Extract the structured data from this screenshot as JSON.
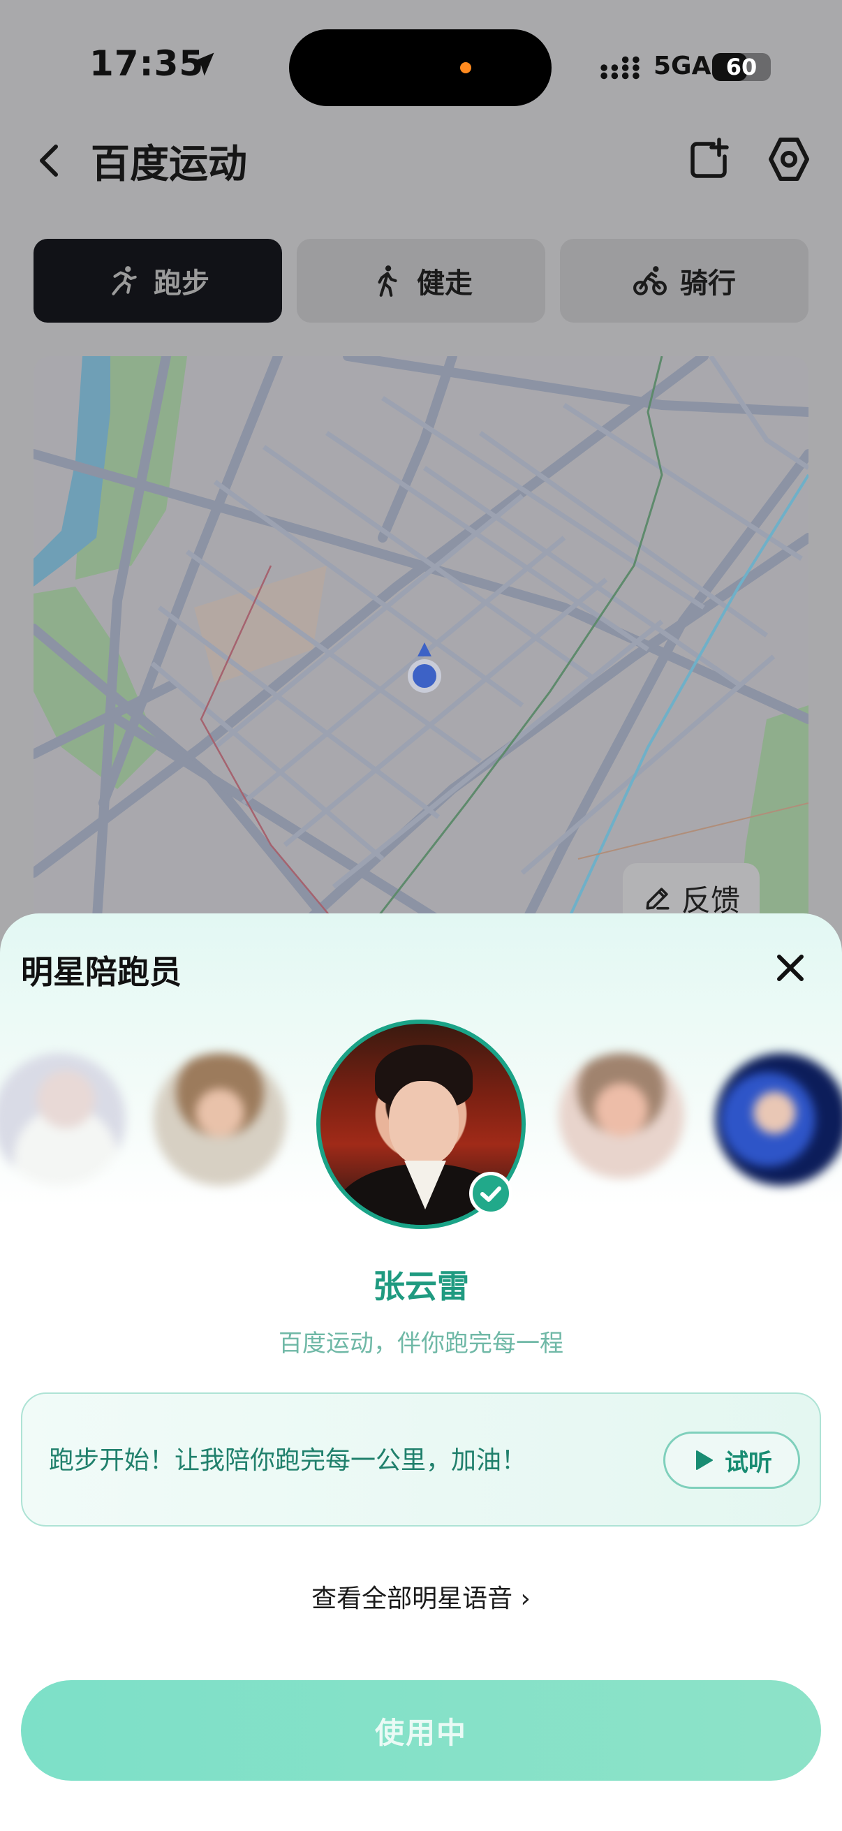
{
  "status_bar": {
    "time": "17:35",
    "network": "5GA",
    "battery": "60",
    "battery_level": 0.6
  },
  "header": {
    "title": "百度运动",
    "back_icon": "chevron-left-icon",
    "share_icon": "share-export-icon",
    "settings_icon": "hexagon-gear-icon"
  },
  "tabs": [
    {
      "label": "跑步",
      "icon": "running-icon",
      "active": true
    },
    {
      "label": "健走",
      "icon": "walking-icon",
      "active": false
    },
    {
      "label": "骑行",
      "icon": "cycling-icon",
      "active": false
    }
  ],
  "map": {
    "feedback_label": "反馈",
    "feedback_icon": "pencil-icon"
  },
  "sheet": {
    "title": "明星陪跑员",
    "close_icon": "close-icon",
    "selected_star": {
      "name": "张云雷",
      "subtitle": "百度运动，伴你跑完每一程"
    },
    "quote": "跑步开始！让我陪你跑完每一公里，加油！",
    "listen_label": "试听",
    "view_all_label": "查看全部明星语音 ›",
    "use_button_label": "使用中"
  },
  "colors": {
    "accent": "#1aa387",
    "accent_text": "#1f9a80",
    "button_bg": "#7de0c8",
    "tab_active_bg": "#111217"
  }
}
